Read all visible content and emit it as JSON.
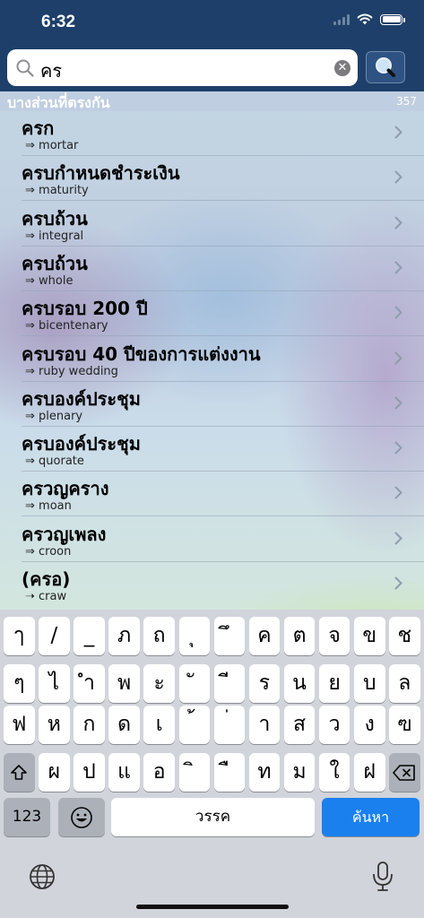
{
  "status": {
    "time": "6:32"
  },
  "search": {
    "query": "คร",
    "clear_icon": "x-circle-icon",
    "button_icon": "magnifier-icon"
  },
  "results": {
    "header_label": "บางส่วนที่ตรงกัน",
    "count": "357",
    "items": [
      {
        "word": "ครก",
        "arrow": "⇒",
        "translation": "mortar"
      },
      {
        "word": "ครบกำหนดชำระเงิน",
        "arrow": "⇒",
        "translation": "maturity"
      },
      {
        "word": "ครบถ้วน",
        "arrow": "⇒",
        "translation": "integral"
      },
      {
        "word": "ครบถ้วน",
        "arrow": "⇒",
        "translation": "whole"
      },
      {
        "word": "ครบรอบ 200 ปี",
        "arrow": "⇒",
        "translation": "bicentenary"
      },
      {
        "word": "ครบรอบ 40 ปีของการแต่งงาน",
        "arrow": "⇒",
        "translation": "ruby wedding"
      },
      {
        "word": "ครบองค์ประชุม",
        "arrow": "⇒",
        "translation": "plenary"
      },
      {
        "word": "ครบองค์ประชุม",
        "arrow": "⇒",
        "translation": "quorate"
      },
      {
        "word": "ครวญคราง",
        "arrow": "⇒",
        "translation": "moan"
      },
      {
        "word": "ครวญเพลง",
        "arrow": "⇒",
        "translation": "croon"
      },
      {
        "word": "(ครอ)",
        "arrow": "➝",
        "translation": "craw"
      }
    ]
  },
  "keyboard": {
    "row1": [
      "ๅ",
      "/",
      "_",
      "ภ",
      "ถ",
      "ุ",
      "ึ",
      "ค",
      "ต",
      "จ",
      "ข",
      "ช"
    ],
    "row2": [
      "ๆ",
      "ไ",
      "ำ",
      "พ",
      "ะ",
      "ั",
      "ี",
      "ร",
      "น",
      "ย",
      "บ",
      "ล"
    ],
    "row3": [
      "ฟ",
      "ห",
      "ก",
      "ด",
      "เ",
      "้",
      "่",
      "า",
      "ส",
      "ว",
      "ง",
      "ฃ"
    ],
    "row4": [
      "ผ",
      "ป",
      "แ",
      "อ",
      "ิ",
      "ื",
      "ท",
      "ม",
      "ใ",
      "ฝ"
    ],
    "numbers_key": "123",
    "space_label": "วรรค",
    "search_label": "ค้นหา",
    "shift_icon": "shift-icon",
    "delete_icon": "delete-icon",
    "emoji_icon": "emoji-icon",
    "globe_icon": "globe-icon",
    "mic_icon": "microphone-icon"
  }
}
